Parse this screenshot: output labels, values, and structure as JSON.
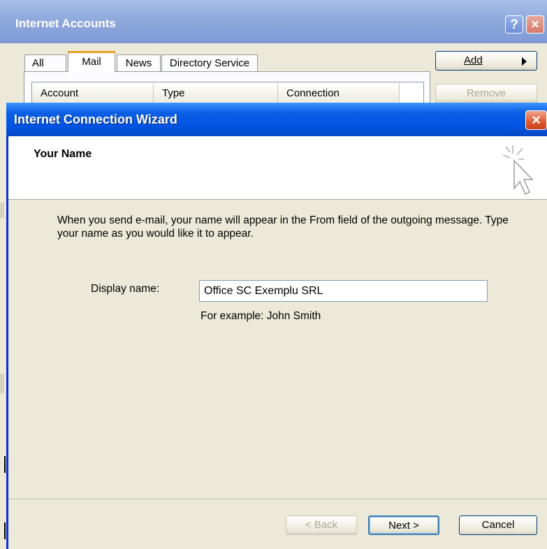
{
  "background_window": {
    "title": "Internet Accounts",
    "help_label": "?",
    "close_label": "×",
    "tabs": [
      {
        "label": "All"
      },
      {
        "label": "Mail",
        "selected": true
      },
      {
        "label": "News"
      },
      {
        "label": "Directory Service"
      }
    ],
    "columns": [
      "Account",
      "Type",
      "Connection"
    ],
    "add_button": "Add",
    "remove_button": "Remove"
  },
  "wizard": {
    "title": "Internet Connection Wizard",
    "close_label": "×",
    "heading": "Your Name",
    "intro": "When you send e-mail, your name will appear in the From field of the outgoing message. Type your name as you would like it to appear.",
    "display_name_label": "Display name:",
    "display_name_value": "Office SC Exemplu SRL",
    "example": "For example: John Smith",
    "buttons": {
      "back": "< Back",
      "next": "Next >",
      "cancel": "Cancel"
    }
  },
  "colors": {
    "wizard_titlebar": "#0054e3",
    "dialog_face": "#ece9d8",
    "close_button": "#e05a30"
  }
}
